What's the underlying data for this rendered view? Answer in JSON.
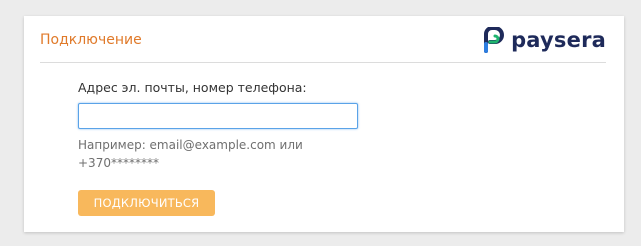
{
  "header": {
    "title": "Подключение",
    "brand": "paysera",
    "brand_icon": "paysera-logo-icon",
    "brand_color": "#1e2a5a"
  },
  "form": {
    "label": "Адрес эл. почты, номер телефона:",
    "input_value": "",
    "hint_line1": "Например: email@example.com или",
    "hint_line2": "+370********",
    "submit_label": "ПОДКЛЮЧИТЬСЯ"
  },
  "colors": {
    "title": "#e07a2a",
    "button": "#f8b85c",
    "input_focus": "#5aa3e8",
    "background": "#ececec"
  }
}
